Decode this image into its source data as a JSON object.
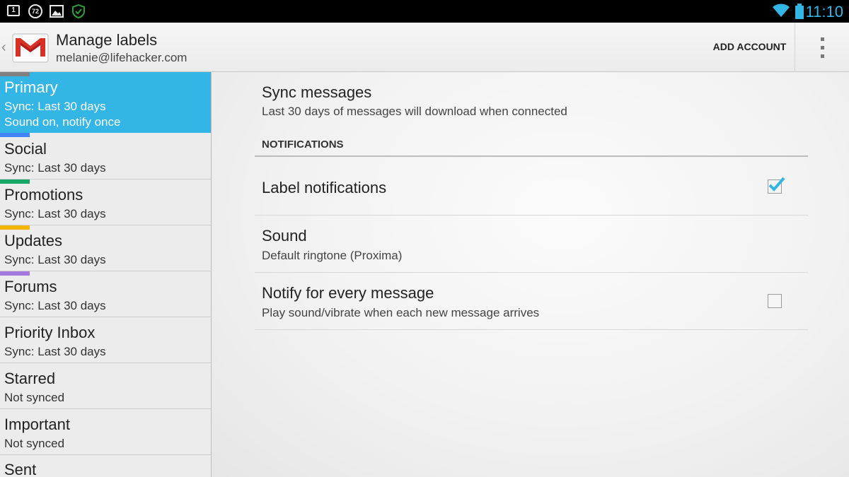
{
  "status_bar": {
    "time": "11:10",
    "notification_icons": [
      {
        "icon": "calendar-icon",
        "label": "1"
      },
      {
        "icon": "temperature-icon",
        "label": "72"
      },
      {
        "icon": "image-icon"
      },
      {
        "icon": "shield-icon"
      }
    ],
    "system_icons": [
      "wifi-icon",
      "battery-icon"
    ],
    "accent_color": "#33b5e5"
  },
  "action_bar": {
    "title": "Manage labels",
    "account": "melanie@lifehacker.com",
    "add_account_label": "ADD ACCOUNT",
    "logo": "gmail-icon"
  },
  "sidebar": {
    "selected_color": "#33b5e5",
    "items": [
      {
        "name": "Primary",
        "sync": "Sync: Last 30 days",
        "extra": "Sound on, notify once",
        "accent": "#808080",
        "selected": true
      },
      {
        "name": "Social",
        "sync": "Sync: Last 30 days",
        "accent": "#4285f4"
      },
      {
        "name": "Promotions",
        "sync": "Sync: Last 30 days",
        "accent": "#16a765"
      },
      {
        "name": "Updates",
        "sync": "Sync: Last 30 days",
        "accent": "#f4b400"
      },
      {
        "name": "Forums",
        "sync": "Sync: Last 30 days",
        "accent": "#a479e2"
      },
      {
        "name": "Priority Inbox",
        "sync": "Sync: Last 30 days"
      },
      {
        "name": "Starred",
        "sync": "Not synced"
      },
      {
        "name": "Important",
        "sync": "Not synced"
      },
      {
        "name": "Sent",
        "sync": ""
      }
    ]
  },
  "settings": {
    "sync_messages": {
      "title": "Sync messages",
      "summary": "Last 30 days of messages will download when connected"
    },
    "notifications_header": "NOTIFICATIONS",
    "label_notifications": {
      "title": "Label notifications",
      "checked": true
    },
    "sound": {
      "title": "Sound",
      "summary": "Default ringtone (Proxima)"
    },
    "notify_every": {
      "title": "Notify for every message",
      "summary": "Play sound/vibrate when each new message arrives",
      "checked": false
    }
  }
}
